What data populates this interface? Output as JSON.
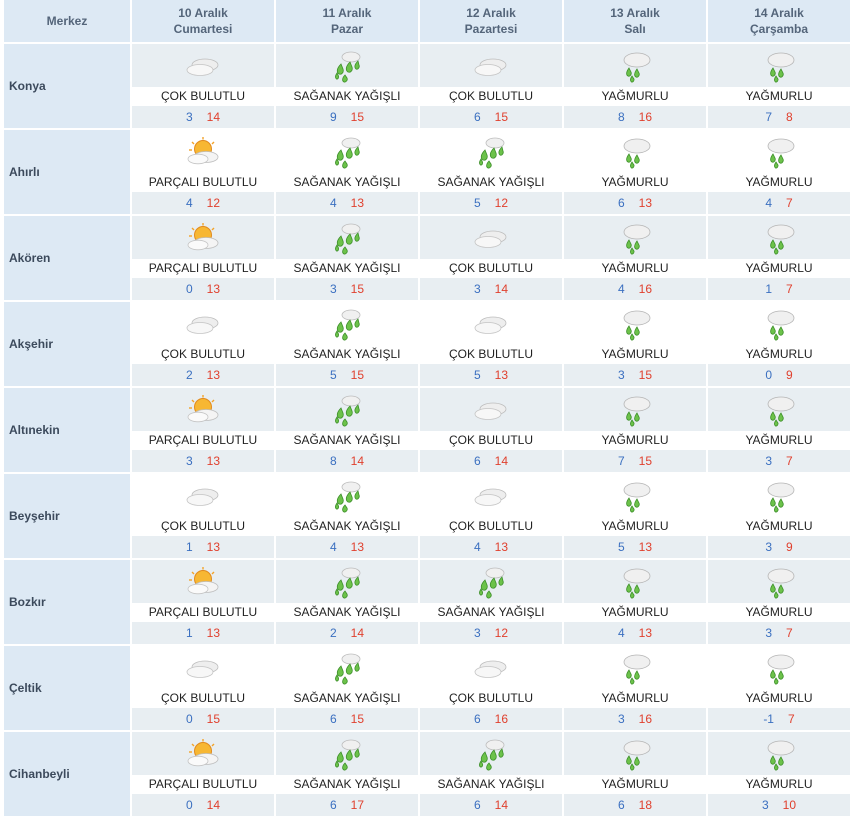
{
  "header": {
    "first": "Merkez",
    "days": [
      {
        "date": "10 Aralık",
        "weekday": "Cumartesi"
      },
      {
        "date": "11 Aralık",
        "weekday": "Pazar"
      },
      {
        "date": "12 Aralık",
        "weekday": "Pazartesi"
      },
      {
        "date": "13 Aralık",
        "weekday": "Salı"
      },
      {
        "date": "14 Aralık",
        "weekday": "Çarşamba"
      }
    ]
  },
  "icons": {
    "cloudy": "cloudy-icon",
    "partly": "partly-cloudy-icon",
    "showers": "showers-icon",
    "rain": "rain-icon"
  },
  "colors": {
    "header_bg": "#dde9f4",
    "min_temp": "#3a6fc0",
    "max_temp": "#e0402e"
  },
  "rows": [
    {
      "name": "Konya",
      "days": [
        {
          "icon": "cloudy",
          "cond": "ÇOK BULUTLU",
          "min": "3",
          "max": "14"
        },
        {
          "icon": "showers",
          "cond": "SAĞANAK YAĞIŞLI",
          "min": "9",
          "max": "15"
        },
        {
          "icon": "cloudy",
          "cond": "ÇOK BULUTLU",
          "min": "6",
          "max": "15"
        },
        {
          "icon": "rain",
          "cond": "YAĞMURLU",
          "min": "8",
          "max": "16"
        },
        {
          "icon": "rain",
          "cond": "YAĞMURLU",
          "min": "7",
          "max": "8"
        }
      ]
    },
    {
      "name": "Ahırlı",
      "days": [
        {
          "icon": "partly",
          "cond": "PARÇALI BULUTLU",
          "min": "4",
          "max": "12"
        },
        {
          "icon": "showers",
          "cond": "SAĞANAK YAĞIŞLI",
          "min": "4",
          "max": "13"
        },
        {
          "icon": "showers",
          "cond": "SAĞANAK YAĞIŞLI",
          "min": "5",
          "max": "12"
        },
        {
          "icon": "rain",
          "cond": "YAĞMURLU",
          "min": "6",
          "max": "13"
        },
        {
          "icon": "rain",
          "cond": "YAĞMURLU",
          "min": "4",
          "max": "7"
        }
      ]
    },
    {
      "name": "Akören",
      "days": [
        {
          "icon": "partly",
          "cond": "PARÇALI BULUTLU",
          "min": "0",
          "max": "13"
        },
        {
          "icon": "showers",
          "cond": "SAĞANAK YAĞIŞLI",
          "min": "3",
          "max": "15"
        },
        {
          "icon": "cloudy",
          "cond": "ÇOK BULUTLU",
          "min": "3",
          "max": "14"
        },
        {
          "icon": "rain",
          "cond": "YAĞMURLU",
          "min": "4",
          "max": "16"
        },
        {
          "icon": "rain",
          "cond": "YAĞMURLU",
          "min": "1",
          "max": "7"
        }
      ]
    },
    {
      "name": "Akşehir",
      "days": [
        {
          "icon": "cloudy",
          "cond": "ÇOK BULUTLU",
          "min": "2",
          "max": "13"
        },
        {
          "icon": "showers",
          "cond": "SAĞANAK YAĞIŞLI",
          "min": "5",
          "max": "15"
        },
        {
          "icon": "cloudy",
          "cond": "ÇOK BULUTLU",
          "min": "5",
          "max": "13"
        },
        {
          "icon": "rain",
          "cond": "YAĞMURLU",
          "min": "3",
          "max": "15"
        },
        {
          "icon": "rain",
          "cond": "YAĞMURLU",
          "min": "0",
          "max": "9"
        }
      ]
    },
    {
      "name": "Altınekin",
      "days": [
        {
          "icon": "partly",
          "cond": "PARÇALI BULUTLU",
          "min": "3",
          "max": "13"
        },
        {
          "icon": "showers",
          "cond": "SAĞANAK YAĞIŞLI",
          "min": "8",
          "max": "14"
        },
        {
          "icon": "cloudy",
          "cond": "ÇOK BULUTLU",
          "min": "6",
          "max": "14"
        },
        {
          "icon": "rain",
          "cond": "YAĞMURLU",
          "min": "7",
          "max": "15"
        },
        {
          "icon": "rain",
          "cond": "YAĞMURLU",
          "min": "3",
          "max": "7"
        }
      ]
    },
    {
      "name": "Beyşehir",
      "days": [
        {
          "icon": "cloudy",
          "cond": "ÇOK BULUTLU",
          "min": "1",
          "max": "13"
        },
        {
          "icon": "showers",
          "cond": "SAĞANAK YAĞIŞLI",
          "min": "4",
          "max": "13"
        },
        {
          "icon": "cloudy",
          "cond": "ÇOK BULUTLU",
          "min": "4",
          "max": "13"
        },
        {
          "icon": "rain",
          "cond": "YAĞMURLU",
          "min": "5",
          "max": "13"
        },
        {
          "icon": "rain",
          "cond": "YAĞMURLU",
          "min": "3",
          "max": "9"
        }
      ]
    },
    {
      "name": "Bozkır",
      "days": [
        {
          "icon": "partly",
          "cond": "PARÇALI BULUTLU",
          "min": "1",
          "max": "13"
        },
        {
          "icon": "showers",
          "cond": "SAĞANAK YAĞIŞLI",
          "min": "2",
          "max": "14"
        },
        {
          "icon": "showers",
          "cond": "SAĞANAK YAĞIŞLI",
          "min": "3",
          "max": "12"
        },
        {
          "icon": "rain",
          "cond": "YAĞMURLU",
          "min": "4",
          "max": "13"
        },
        {
          "icon": "rain",
          "cond": "YAĞMURLU",
          "min": "3",
          "max": "7"
        }
      ]
    },
    {
      "name": "Çeltik",
      "days": [
        {
          "icon": "cloudy",
          "cond": "ÇOK BULUTLU",
          "min": "0",
          "max": "15"
        },
        {
          "icon": "showers",
          "cond": "SAĞANAK YAĞIŞLI",
          "min": "6",
          "max": "15"
        },
        {
          "icon": "cloudy",
          "cond": "ÇOK BULUTLU",
          "min": "6",
          "max": "16"
        },
        {
          "icon": "rain",
          "cond": "YAĞMURLU",
          "min": "3",
          "max": "16"
        },
        {
          "icon": "rain",
          "cond": "YAĞMURLU",
          "min": "-1",
          "max": "7"
        }
      ]
    },
    {
      "name": "Cihanbeyli",
      "days": [
        {
          "icon": "partly",
          "cond": "PARÇALI BULUTLU",
          "min": "0",
          "max": "14"
        },
        {
          "icon": "showers",
          "cond": "SAĞANAK YAĞIŞLI",
          "min": "6",
          "max": "17"
        },
        {
          "icon": "showers",
          "cond": "SAĞANAK YAĞIŞLI",
          "min": "6",
          "max": "14"
        },
        {
          "icon": "rain",
          "cond": "YAĞMURLU",
          "min": "6",
          "max": "18"
        },
        {
          "icon": "rain",
          "cond": "YAĞMURLU",
          "min": "3",
          "max": "10"
        }
      ]
    }
  ]
}
